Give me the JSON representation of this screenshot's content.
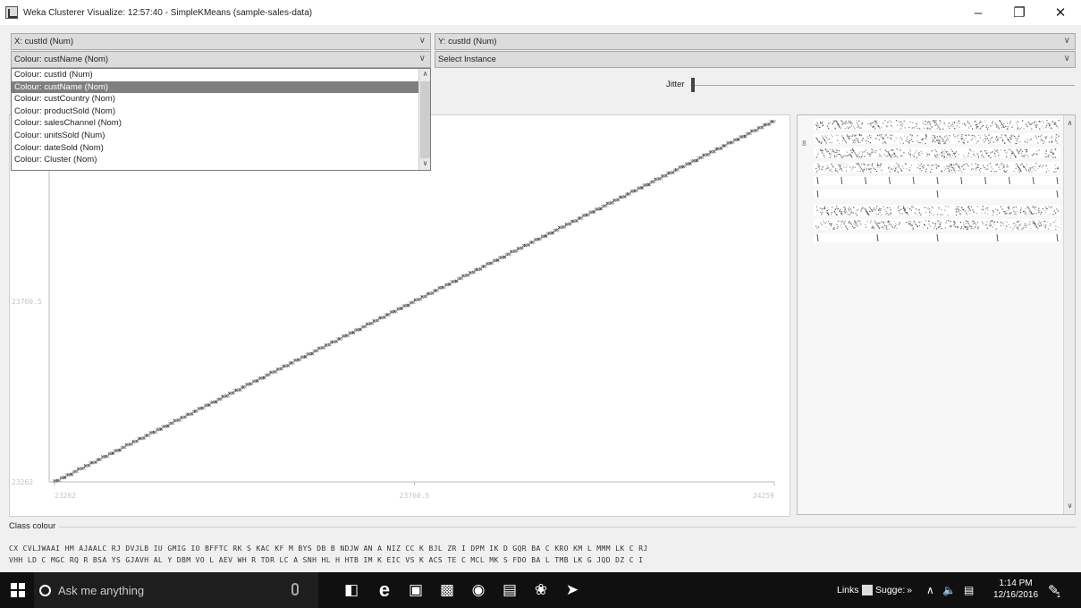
{
  "window": {
    "title": "Weka Clusterer Visualize: 12:57:40 - SimpleKMeans (sample-sales-data)",
    "minimize": "–",
    "restore": "❐",
    "close": "✕"
  },
  "controls": {
    "x_axis": "X: custId (Num)",
    "y_axis": "Y: custId (Num)",
    "colour": "Colour: custName (Nom)",
    "select_instance": "Select Instance",
    "jitter_label": "Jitter"
  },
  "colour_dropdown": {
    "options": [
      "Colour: custId (Num)",
      "Colour: custName (Nom)",
      "Colour: custCountry (Nom)",
      "Colour: productSold (Nom)",
      "Colour: salesChannel (Nom)",
      "Colour: unitsSold (Num)",
      "Colour: dateSold (Nom)",
      "Colour: Cluster (Nom)"
    ],
    "selected_index": 1
  },
  "chart_data": {
    "type": "scatter",
    "x_ticks": [
      "23262",
      "23760.5",
      "24259"
    ],
    "y_ticks": [
      "23262",
      "23760.5"
    ],
    "xlim": [
      23262,
      24259
    ],
    "ylim": [
      23262,
      24259
    ],
    "series": [
      {
        "x": [
          23262,
          24259
        ],
        "y": [
          23262,
          24259
        ]
      }
    ],
    "point_colors": [
      "#666666",
      "#999999",
      "#444444",
      "#b0b0b0"
    ]
  },
  "legend": {
    "marker": "8"
  },
  "class_colour": {
    "label": "Class colour",
    "line1": "CX  CVLJWAAI  HM AJAALC RJ DVJLB  IU GMIG  IO BFFTC  RK S KAC  KF M BYS  DB B NDJW  AN A NIZ  CC K BJL  ZR I DPM  IK D GQR  BA C KRO  KM L MMM  LK C RJ",
    "line2": "VHH  LD C MGC  RQ R BSA  YS GJAVH  AL Y DBM  VO L AEV  WH R TDR  LC A SNH  HL H HTB  IM K EIC  VS K ACS  TE C MCL  MK S FDO  BA L TMB  LK G JQD  DZ C I"
  },
  "taskbar": {
    "search_placeholder": "Ask me anything",
    "links_label": "Links",
    "suggest_label": "Sugge:",
    "overflow": "»",
    "time": "1:14 PM",
    "date": "12/16/2016",
    "notification_count": "1"
  }
}
